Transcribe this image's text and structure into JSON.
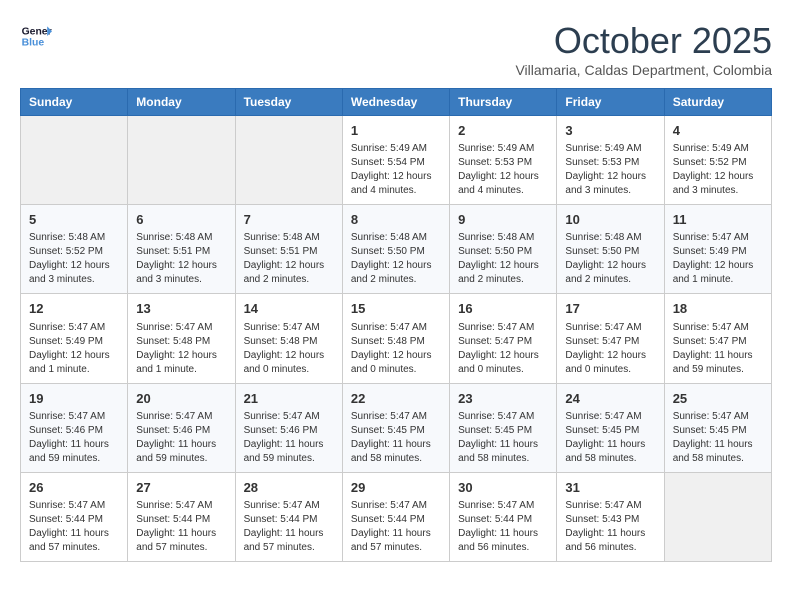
{
  "logo": {
    "line1": "General",
    "line2": "Blue"
  },
  "title": "October 2025",
  "subtitle": "Villamaria, Caldas Department, Colombia",
  "days_of_week": [
    "Sunday",
    "Monday",
    "Tuesday",
    "Wednesday",
    "Thursday",
    "Friday",
    "Saturday"
  ],
  "weeks": [
    [
      {
        "day": "",
        "detail": ""
      },
      {
        "day": "",
        "detail": ""
      },
      {
        "day": "",
        "detail": ""
      },
      {
        "day": "1",
        "detail": "Sunrise: 5:49 AM\nSunset: 5:54 PM\nDaylight: 12 hours\nand 4 minutes."
      },
      {
        "day": "2",
        "detail": "Sunrise: 5:49 AM\nSunset: 5:53 PM\nDaylight: 12 hours\nand 4 minutes."
      },
      {
        "day": "3",
        "detail": "Sunrise: 5:49 AM\nSunset: 5:53 PM\nDaylight: 12 hours\nand 3 minutes."
      },
      {
        "day": "4",
        "detail": "Sunrise: 5:49 AM\nSunset: 5:52 PM\nDaylight: 12 hours\nand 3 minutes."
      }
    ],
    [
      {
        "day": "5",
        "detail": "Sunrise: 5:48 AM\nSunset: 5:52 PM\nDaylight: 12 hours\nand 3 minutes."
      },
      {
        "day": "6",
        "detail": "Sunrise: 5:48 AM\nSunset: 5:51 PM\nDaylight: 12 hours\nand 3 minutes."
      },
      {
        "day": "7",
        "detail": "Sunrise: 5:48 AM\nSunset: 5:51 PM\nDaylight: 12 hours\nand 2 minutes."
      },
      {
        "day": "8",
        "detail": "Sunrise: 5:48 AM\nSunset: 5:50 PM\nDaylight: 12 hours\nand 2 minutes."
      },
      {
        "day": "9",
        "detail": "Sunrise: 5:48 AM\nSunset: 5:50 PM\nDaylight: 12 hours\nand 2 minutes."
      },
      {
        "day": "10",
        "detail": "Sunrise: 5:48 AM\nSunset: 5:50 PM\nDaylight: 12 hours\nand 2 minutes."
      },
      {
        "day": "11",
        "detail": "Sunrise: 5:47 AM\nSunset: 5:49 PM\nDaylight: 12 hours\nand 1 minute."
      }
    ],
    [
      {
        "day": "12",
        "detail": "Sunrise: 5:47 AM\nSunset: 5:49 PM\nDaylight: 12 hours\nand 1 minute."
      },
      {
        "day": "13",
        "detail": "Sunrise: 5:47 AM\nSunset: 5:48 PM\nDaylight: 12 hours\nand 1 minute."
      },
      {
        "day": "14",
        "detail": "Sunrise: 5:47 AM\nSunset: 5:48 PM\nDaylight: 12 hours\nand 0 minutes."
      },
      {
        "day": "15",
        "detail": "Sunrise: 5:47 AM\nSunset: 5:48 PM\nDaylight: 12 hours\nand 0 minutes."
      },
      {
        "day": "16",
        "detail": "Sunrise: 5:47 AM\nSunset: 5:47 PM\nDaylight: 12 hours\nand 0 minutes."
      },
      {
        "day": "17",
        "detail": "Sunrise: 5:47 AM\nSunset: 5:47 PM\nDaylight: 12 hours\nand 0 minutes."
      },
      {
        "day": "18",
        "detail": "Sunrise: 5:47 AM\nSunset: 5:47 PM\nDaylight: 11 hours\nand 59 minutes."
      }
    ],
    [
      {
        "day": "19",
        "detail": "Sunrise: 5:47 AM\nSunset: 5:46 PM\nDaylight: 11 hours\nand 59 minutes."
      },
      {
        "day": "20",
        "detail": "Sunrise: 5:47 AM\nSunset: 5:46 PM\nDaylight: 11 hours\nand 59 minutes."
      },
      {
        "day": "21",
        "detail": "Sunrise: 5:47 AM\nSunset: 5:46 PM\nDaylight: 11 hours\nand 59 minutes."
      },
      {
        "day": "22",
        "detail": "Sunrise: 5:47 AM\nSunset: 5:45 PM\nDaylight: 11 hours\nand 58 minutes."
      },
      {
        "day": "23",
        "detail": "Sunrise: 5:47 AM\nSunset: 5:45 PM\nDaylight: 11 hours\nand 58 minutes."
      },
      {
        "day": "24",
        "detail": "Sunrise: 5:47 AM\nSunset: 5:45 PM\nDaylight: 11 hours\nand 58 minutes."
      },
      {
        "day": "25",
        "detail": "Sunrise: 5:47 AM\nSunset: 5:45 PM\nDaylight: 11 hours\nand 58 minutes."
      }
    ],
    [
      {
        "day": "26",
        "detail": "Sunrise: 5:47 AM\nSunset: 5:44 PM\nDaylight: 11 hours\nand 57 minutes."
      },
      {
        "day": "27",
        "detail": "Sunrise: 5:47 AM\nSunset: 5:44 PM\nDaylight: 11 hours\nand 57 minutes."
      },
      {
        "day": "28",
        "detail": "Sunrise: 5:47 AM\nSunset: 5:44 PM\nDaylight: 11 hours\nand 57 minutes."
      },
      {
        "day": "29",
        "detail": "Sunrise: 5:47 AM\nSunset: 5:44 PM\nDaylight: 11 hours\nand 57 minutes."
      },
      {
        "day": "30",
        "detail": "Sunrise: 5:47 AM\nSunset: 5:44 PM\nDaylight: 11 hours\nand 56 minutes."
      },
      {
        "day": "31",
        "detail": "Sunrise: 5:47 AM\nSunset: 5:43 PM\nDaylight: 11 hours\nand 56 minutes."
      },
      {
        "day": "",
        "detail": ""
      }
    ]
  ]
}
